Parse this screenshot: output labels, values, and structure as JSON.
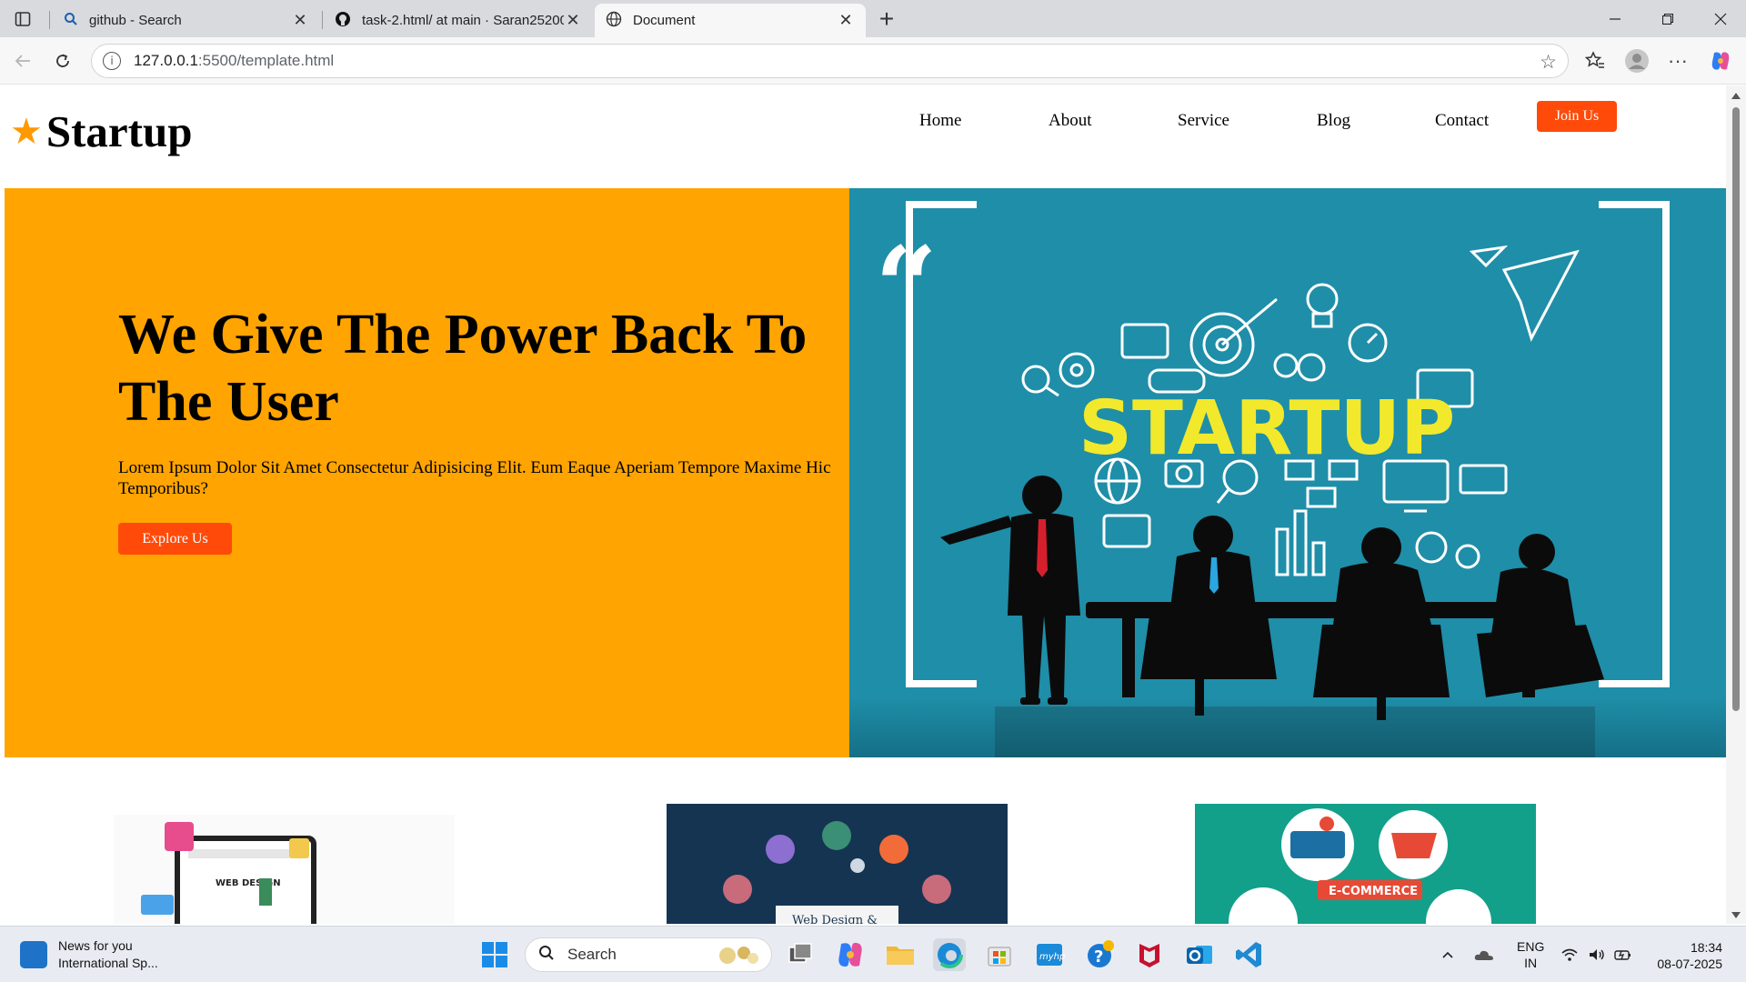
{
  "browser": {
    "tabs": [
      {
        "title": "github - Search",
        "icon": "search-icon"
      },
      {
        "title": "task-2.html/ at main · Saran25200",
        "icon": "github-icon"
      },
      {
        "title": "Document",
        "icon": "globe-icon",
        "active": true
      }
    ],
    "url_host": "127.0.0.1",
    "url_path": ":5500/template.html"
  },
  "site": {
    "logo_text": "Startup",
    "nav": [
      "Home",
      "About",
      "Service",
      "Blog",
      "Contact"
    ],
    "join_label": "Join Us",
    "hero": {
      "title": "We Give The Power Back To The User",
      "text": "Lorem Ipsum Dolor Sit Amet Consectetur Adipisicing Elit. Eum Eaque Aperiam Tempore Maxime Hic Temporibus?",
      "cta_label": "Explore Us",
      "image_word": "STARTUP"
    },
    "cards": [
      {
        "caption": "WEB DESIGN"
      },
      {
        "caption": "Web Design &"
      },
      {
        "caption": "E-COMMERCE"
      }
    ]
  },
  "taskbar": {
    "news_title": "News for you",
    "news_sub": "International Sp...",
    "search_label": "Search",
    "lang_top": "ENG",
    "lang_bottom": "IN",
    "time": "18:34",
    "date": "08-07-2025"
  },
  "colors": {
    "hero_orange": "#ffa400",
    "button_red": "#ff4a0a",
    "hero_teal": "#1f8ea8",
    "startup_yellow": "#f2e92c"
  }
}
